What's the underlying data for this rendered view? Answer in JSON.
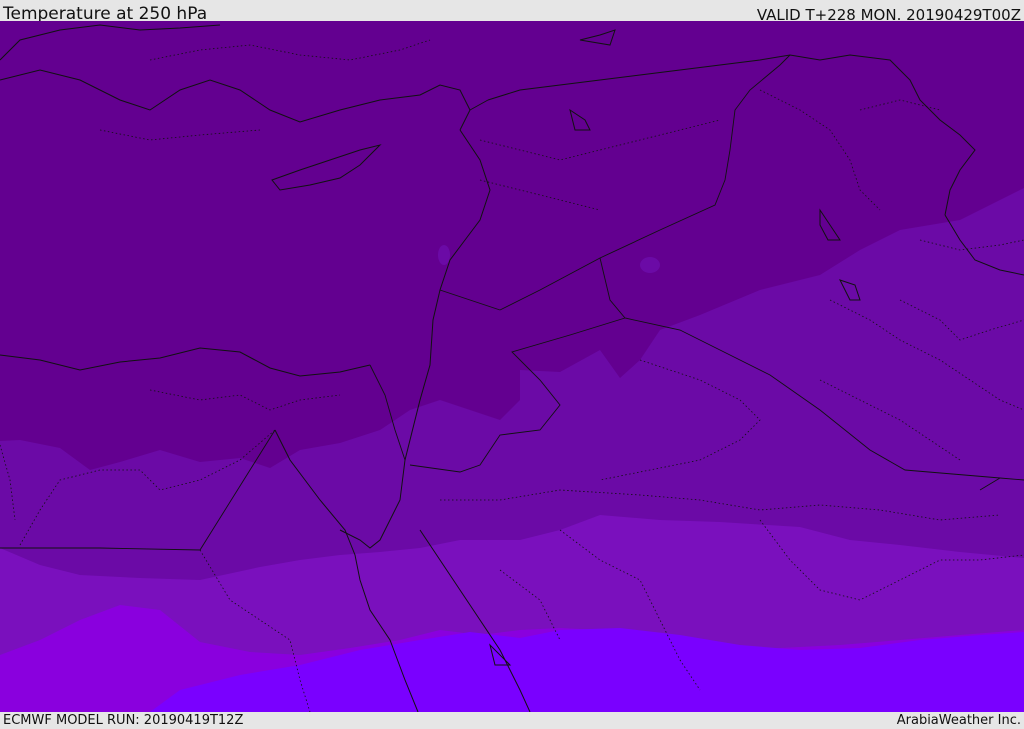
{
  "header": {
    "title": "Temperature at 250 hPa",
    "valid": "VALID T+228 MON. 20190429T00Z"
  },
  "footer": {
    "model_run": "ECMWF MODEL RUN: 20190419T12Z",
    "credit": "ArabiaWeather Inc."
  },
  "map": {
    "field": "temperature",
    "level": "250 hPa",
    "fill_colors": [
      "#630090",
      "#6b0aa6",
      "#7a10bd",
      "#8a00de",
      "#7a00ff"
    ],
    "boundary_color": "#111111"
  }
}
